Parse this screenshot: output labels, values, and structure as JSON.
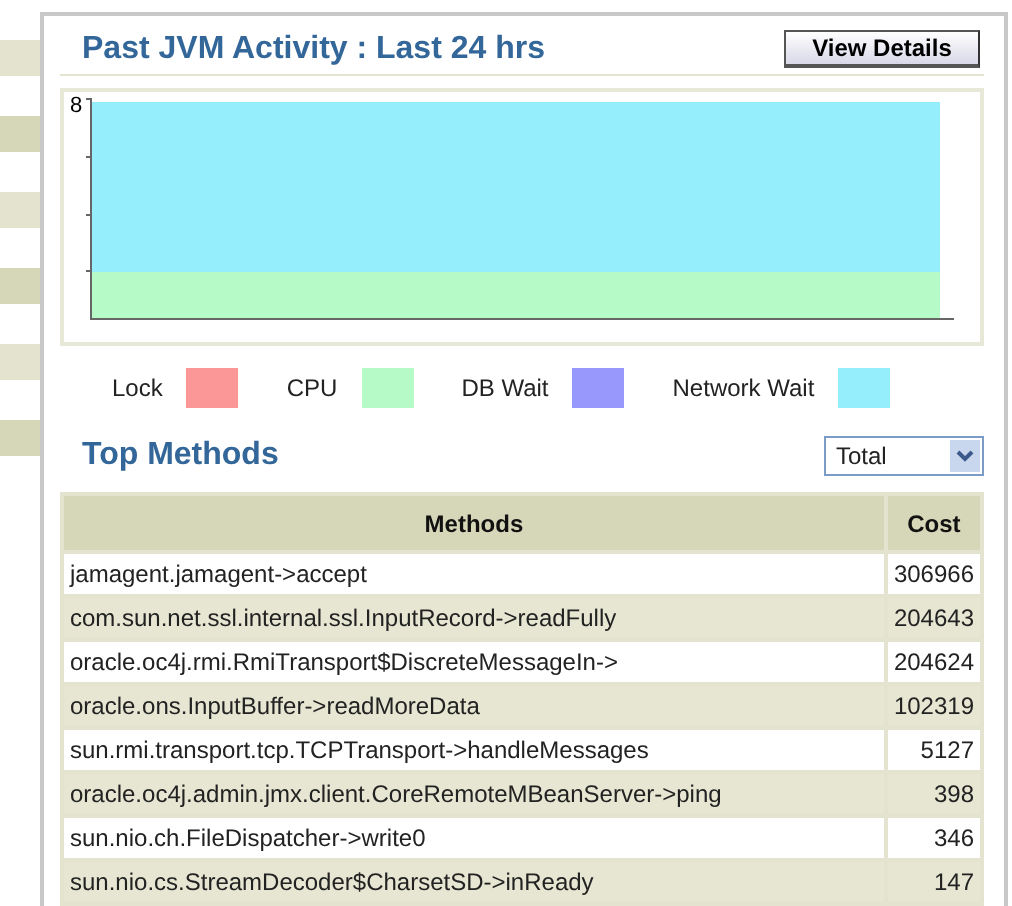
{
  "panel": {
    "title": "Past JVM Activity : Last 24 hrs",
    "details_button": "View Details"
  },
  "activity_chart": {
    "y_axis_label": "8",
    "series": [
      {
        "color": "#94eefc"
      },
      {
        "color": "#b6fbc7"
      }
    ]
  },
  "legend": [
    {
      "label": "Lock",
      "color": "#fc9797"
    },
    {
      "label": "CPU",
      "color": "#b6fbc7"
    },
    {
      "label": "DB Wait",
      "color": "#9797fc"
    },
    {
      "label": "Network Wait",
      "color": "#94eefc"
    }
  ],
  "top_methods": {
    "title": "Top Methods",
    "filter": {
      "value": "Total"
    },
    "columns": [
      "Methods",
      "Cost"
    ],
    "rows": [
      [
        "jamagent.jamagent->accept",
        "306966"
      ],
      [
        "com.sun.net.ssl.internal.ssl.InputRecord->readFully",
        "204643"
      ],
      [
        "oracle.oc4j.rmi.RmiTransport$DiscreteMessageIn->",
        "204624"
      ],
      [
        "oracle.ons.InputBuffer->readMoreData",
        "102319"
      ],
      [
        "sun.rmi.transport.tcp.TCPTransport->handleMessages",
        "5127"
      ],
      [
        "oracle.oc4j.admin.jmx.client.CoreRemoteMBeanServer->ping",
        "398"
      ],
      [
        "sun.nio.ch.FileDispatcher->write0",
        "346"
      ],
      [
        "sun.nio.cs.StreamDecoder$CharsetSD->inReady",
        "147"
      ]
    ]
  }
}
